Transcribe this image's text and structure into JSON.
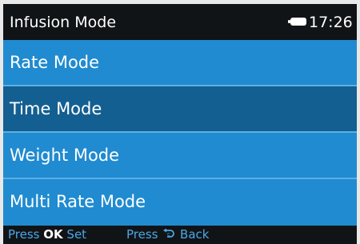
{
  "header": {
    "title": "Infusion Mode",
    "time": "17:26"
  },
  "menu": {
    "items": [
      {
        "label": "Rate Mode",
        "selected": false
      },
      {
        "label": "Time Mode",
        "selected": true
      },
      {
        "label": "Weight Mode",
        "selected": false
      },
      {
        "label": "Multi Rate Mode",
        "selected": false
      }
    ]
  },
  "footer": {
    "set_prefix": "Press",
    "set_key": "OK",
    "set_action": "Set",
    "back_prefix": "Press",
    "back_icon": "back-return-icon",
    "back_action": "Back"
  },
  "colors": {
    "screen_background": "#208bd0",
    "selected_row": "#145f91",
    "title_bar": "#111417",
    "footer_text": "#4aa8e8"
  }
}
